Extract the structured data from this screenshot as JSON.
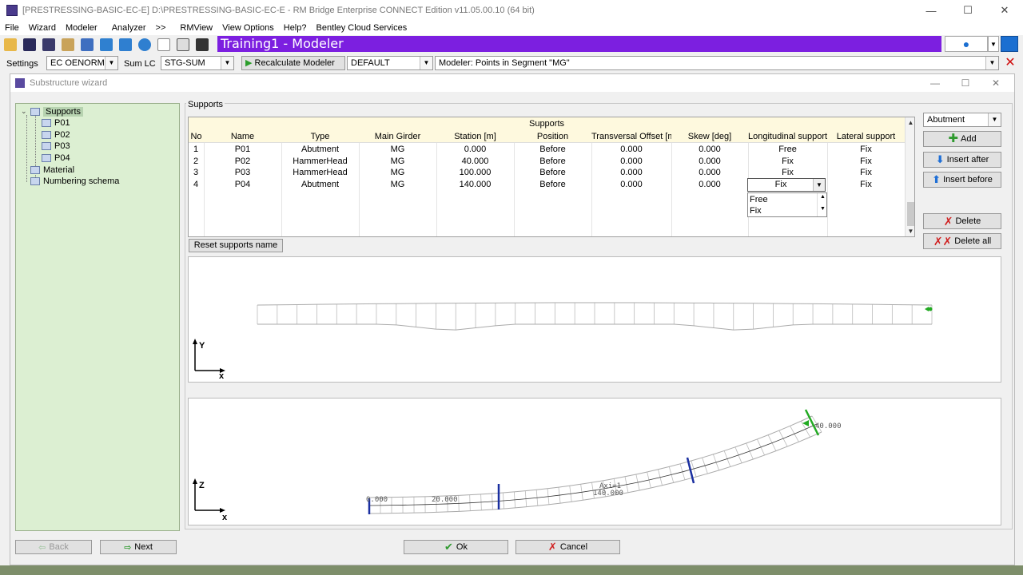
{
  "window": {
    "title": "[PRESTRESSING-BASIC-EC-E] D:\\PRESTRESSING-BASIC-EC-E - RM Bridge Enterprise CONNECT Edition v11.05.00.10 (64 bit)",
    "minimize": "—",
    "maximize": "☐",
    "close": "✕"
  },
  "menu": [
    "File",
    "Wizard",
    "Modeler",
    "Analyzer",
    ">>",
    "RMView",
    "View Options",
    "Help?",
    "Bentley Cloud Services"
  ],
  "toolbar": {
    "modeler_title": "Training1 - Modeler"
  },
  "settings": {
    "settings_label": "Settings",
    "norm_value": "EC OENORM",
    "sumlc_label": "Sum LC",
    "sumlc_value": "STG-SUM",
    "recalc_label": "Recalculate Modeler",
    "default_value": "DEFAULT",
    "status_value": "Modeler: Points in Segment \"MG\""
  },
  "dialog": {
    "title": "Substructure wizard",
    "group_label": "Supports",
    "tree": {
      "root": "Supports",
      "children": [
        "P01",
        "P02",
        "P03",
        "P04"
      ],
      "material": "Material",
      "numbering": "Numbering schema"
    },
    "grid": {
      "caption": "Supports",
      "columns": [
        "No",
        "Name",
        "Type",
        "Main Girder",
        "Station [m]",
        "Position",
        "Transversal Offset [m]",
        "Skew [deg]",
        "Longitudinal support",
        "Lateral support"
      ],
      "rows": [
        [
          "1",
          "P01",
          "Abutment",
          "MG",
          "0.000",
          "Before",
          "0.000",
          "0.000",
          "Free",
          "Fix"
        ],
        [
          "2",
          "P02",
          "HammerHead",
          "MG",
          "40.000",
          "Before",
          "0.000",
          "0.000",
          "Fix",
          "Fix"
        ],
        [
          "3",
          "P03",
          "HammerHead",
          "MG",
          "100.000",
          "Before",
          "0.000",
          "0.000",
          "Fix",
          "Fix"
        ],
        [
          "4",
          "P04",
          "Abutment",
          "MG",
          "140.000",
          "Before",
          "0.000",
          "0.000",
          "Fix",
          "Fix"
        ]
      ],
      "editor_value": "Fix",
      "dropdown_options": [
        "Free",
        "Fix"
      ]
    },
    "type_combo": "Abutment",
    "buttons": {
      "add": "Add",
      "insert_after": "Insert after",
      "insert_before": "Insert before",
      "delete": "Delete",
      "delete_all": "Delete all",
      "reset": "Reset supports name",
      "back": "Back",
      "next": "Next",
      "ok": "Ok",
      "cancel": "Cancel"
    },
    "plan_view": {
      "axis_y": "Y",
      "axis_x": "x"
    },
    "elevation_view": {
      "axis_z": "Z",
      "axis_x": "x",
      "station_labels": [
        "0.000",
        "20.000",
        "40.000",
        "140.000"
      ],
      "axis_label": "Axi=1"
    }
  }
}
